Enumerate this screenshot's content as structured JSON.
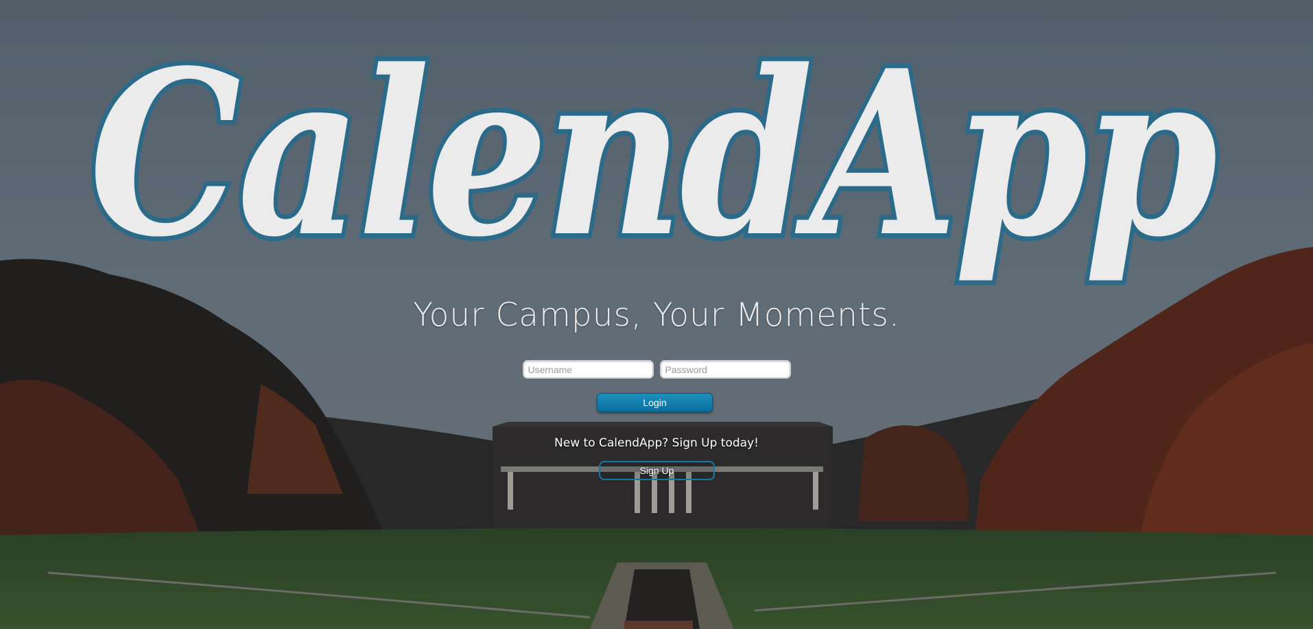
{
  "logo_text": "CalendApp",
  "tagline": "Your Campus, Your Moments.",
  "login": {
    "username_placeholder": "Username",
    "password_placeholder": "Password",
    "login_label": "Login"
  },
  "signup": {
    "prompt": "New to CalendApp? Sign Up today!",
    "button_label": "Sign Up"
  },
  "colors": {
    "accent": "#1a7fb0",
    "logo_fill": "#ebebeb",
    "logo_outline": "#2c6a8a"
  }
}
